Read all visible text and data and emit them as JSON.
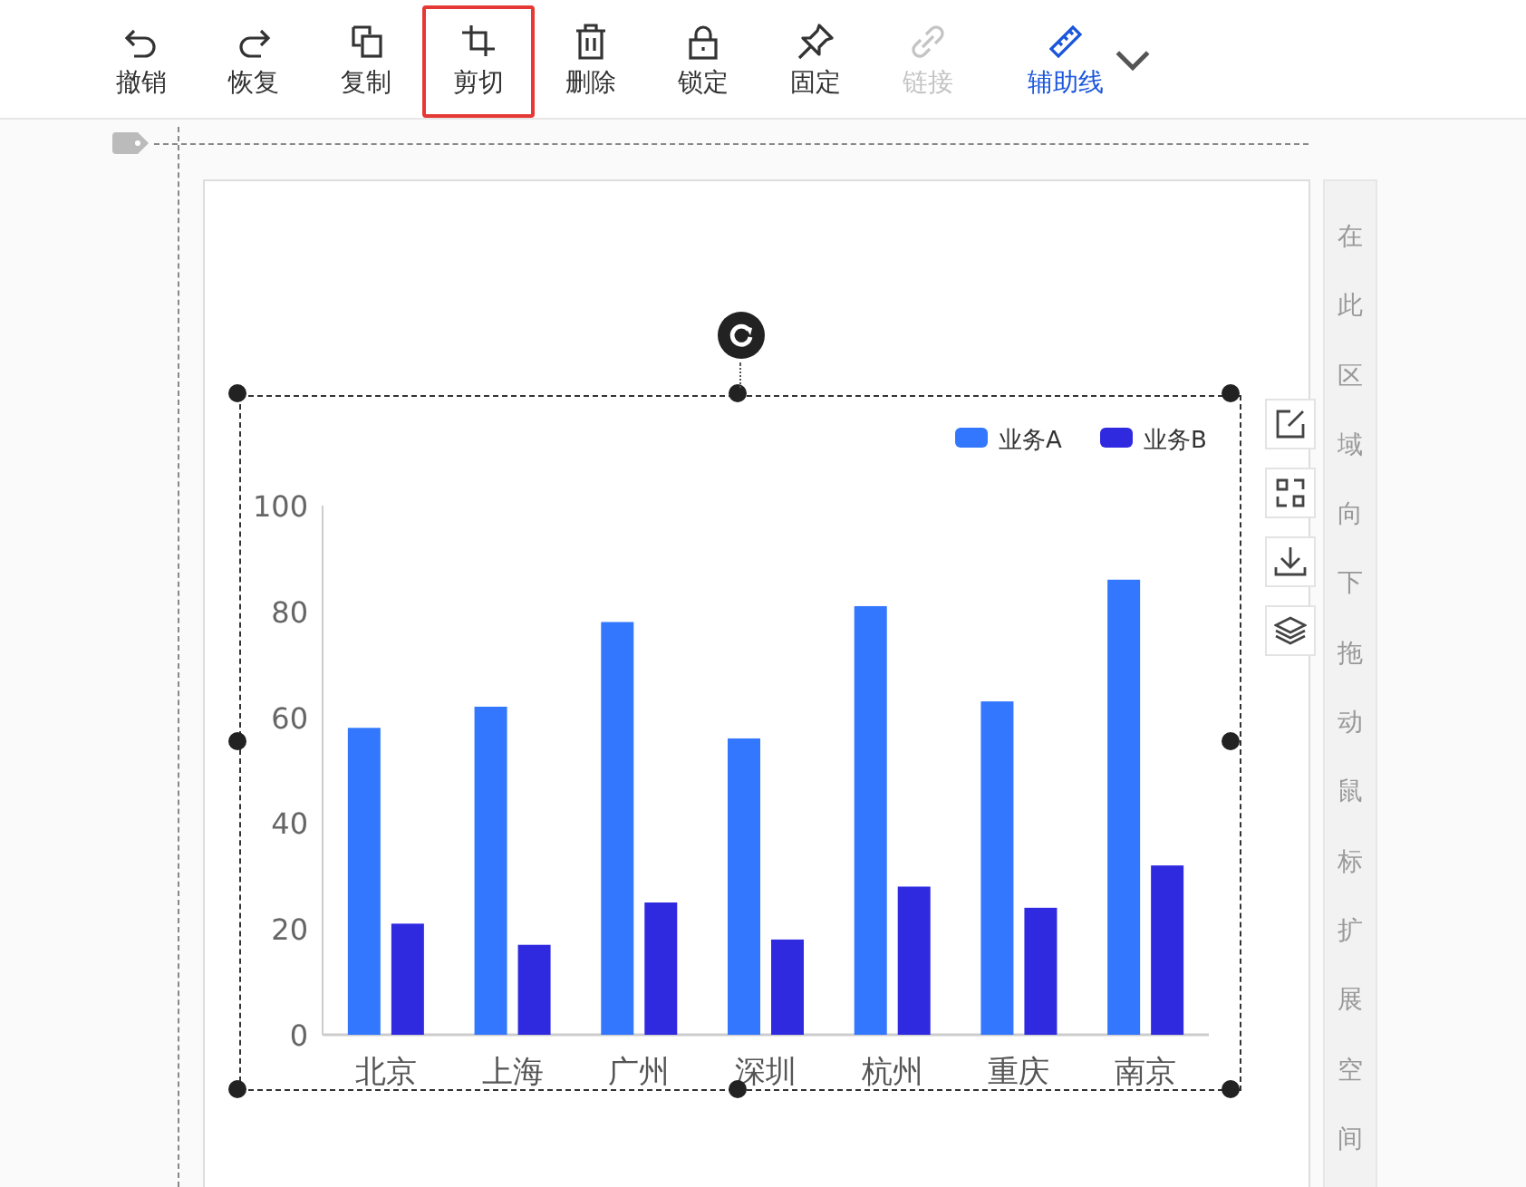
{
  "toolbar": {
    "items": [
      {
        "label": "撤销",
        "kind": "undo",
        "selected": false,
        "disabled": false
      },
      {
        "label": "恢复",
        "kind": "redo",
        "selected": false,
        "disabled": false
      },
      {
        "label": "复制",
        "kind": "copy",
        "selected": false,
        "disabled": false
      },
      {
        "label": "剪切",
        "kind": "crop",
        "selected": true,
        "disabled": false
      },
      {
        "label": "删除",
        "kind": "delete",
        "selected": false,
        "disabled": false
      },
      {
        "label": "锁定",
        "kind": "lock",
        "selected": false,
        "disabled": false
      },
      {
        "label": "固定",
        "kind": "pin",
        "selected": false,
        "disabled": false
      },
      {
        "label": "链接",
        "kind": "link",
        "selected": false,
        "disabled": true
      }
    ],
    "guides": {
      "label": "辅助线",
      "on": true
    }
  },
  "canvas": {
    "side_hint": "在此区域向下拖动鼠标扩展空间",
    "chart_data": {
      "type": "bar",
      "categories": [
        "北京",
        "上海",
        "广州",
        "深圳",
        "杭州",
        "重庆",
        "南京"
      ],
      "series": [
        {
          "name": "业务A",
          "color": "#3377ff",
          "values": [
            58,
            62,
            78,
            56,
            81,
            63,
            86
          ]
        },
        {
          "name": "业务B",
          "color": "#2f2ae0",
          "values": [
            21,
            17,
            25,
            18,
            28,
            24,
            32
          ]
        }
      ],
      "legend": true,
      "ylim": [
        0,
        100
      ],
      "yticks": [
        0,
        20,
        40,
        60,
        80,
        100
      ]
    }
  }
}
